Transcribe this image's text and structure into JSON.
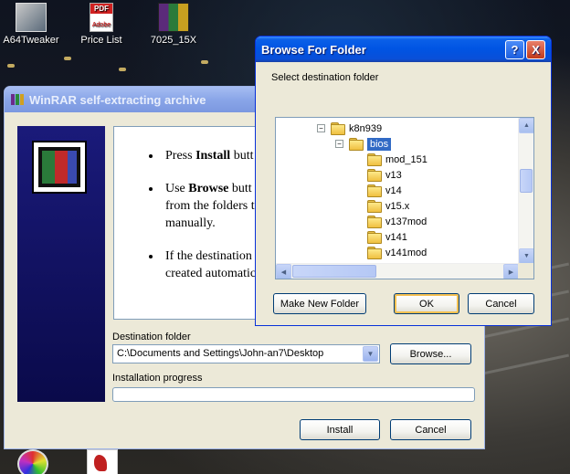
{
  "desktop": {
    "icons": [
      {
        "label": "A64Tweaker"
      },
      {
        "label": "Price List"
      },
      {
        "label": "7025_15X"
      }
    ]
  },
  "winrar": {
    "title": "WinRAR self-extracting archive",
    "instructions": {
      "item1_pre": "Press ",
      "item1_bold": "Install",
      "item1_post": " butt",
      "item2_pre": "Use ",
      "item2_bold": "Browse",
      "item2_post": " butt",
      "item2_line2": "from the folders t",
      "item2_line3": "manually.",
      "item3_line1": "If the destination f",
      "item3_line2": "created automatic"
    },
    "destination_label": "Destination folder",
    "destination_value": "C:\\Documents and Settings\\John-an7\\Desktop",
    "browse_button": "Browse...",
    "progress_label": "Installation progress",
    "progress": 0,
    "install_button": "Install",
    "cancel_button": "Cancel"
  },
  "browse": {
    "title": "Browse For Folder",
    "help_button": "?",
    "close_button": "X",
    "prompt": "Select destination folder",
    "tree": [
      {
        "label": "k8n939",
        "expander": "−",
        "selected": false
      },
      {
        "label": "bios",
        "expander": "−",
        "selected": true
      },
      {
        "label": "mod_151"
      },
      {
        "label": "v13"
      },
      {
        "label": "v14"
      },
      {
        "label": "v15.x"
      },
      {
        "label": "v137mod"
      },
      {
        "label": "v141"
      },
      {
        "label": "v141mod"
      }
    ],
    "make_new_folder_button": "Make New Folder",
    "ok_button": "OK",
    "cancel_button": "Cancel"
  },
  "colors": {
    "title_active": "#0054e3",
    "title_inactive": "#8aa6e8",
    "selection": "#316ac5",
    "window_face": "#ece9d8"
  }
}
